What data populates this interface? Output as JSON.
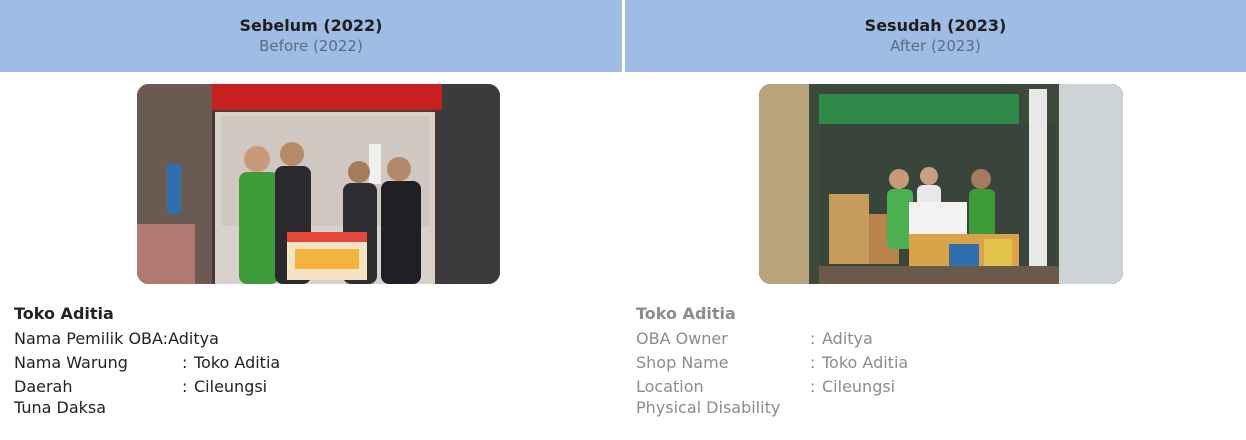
{
  "left": {
    "header_title": "Sebelum (2022)",
    "header_subtitle": "Before (2022)",
    "shop_title": "Toko Aditia",
    "rows": [
      {
        "label": "Nama Pemilik OBA",
        "sep": ":",
        "value": "Aditya"
      },
      {
        "label": "Nama Warung",
        "sep": ":",
        "value": "Toko Aditia"
      },
      {
        "label": "Daerah",
        "sep": ":",
        "value": "Cileungsi"
      }
    ],
    "extra": "Tuna Daksa"
  },
  "right": {
    "header_title": "Sesudah (2023)",
    "header_subtitle": "After (2023)",
    "shop_title": "Toko Aditia",
    "rows": [
      {
        "label": "OBA Owner",
        "sep": ":",
        "value": "Aditya"
      },
      {
        "label": "Shop Name",
        "sep": ":",
        "value": "Toko Aditia"
      },
      {
        "label": "Location",
        "sep": ":",
        "value": "Cileungsi"
      }
    ],
    "extra": "Physical Disability"
  },
  "colors": {
    "header_bg": "#9fbde4",
    "left_text": "#222222",
    "right_text": "#8c8c8c"
  }
}
